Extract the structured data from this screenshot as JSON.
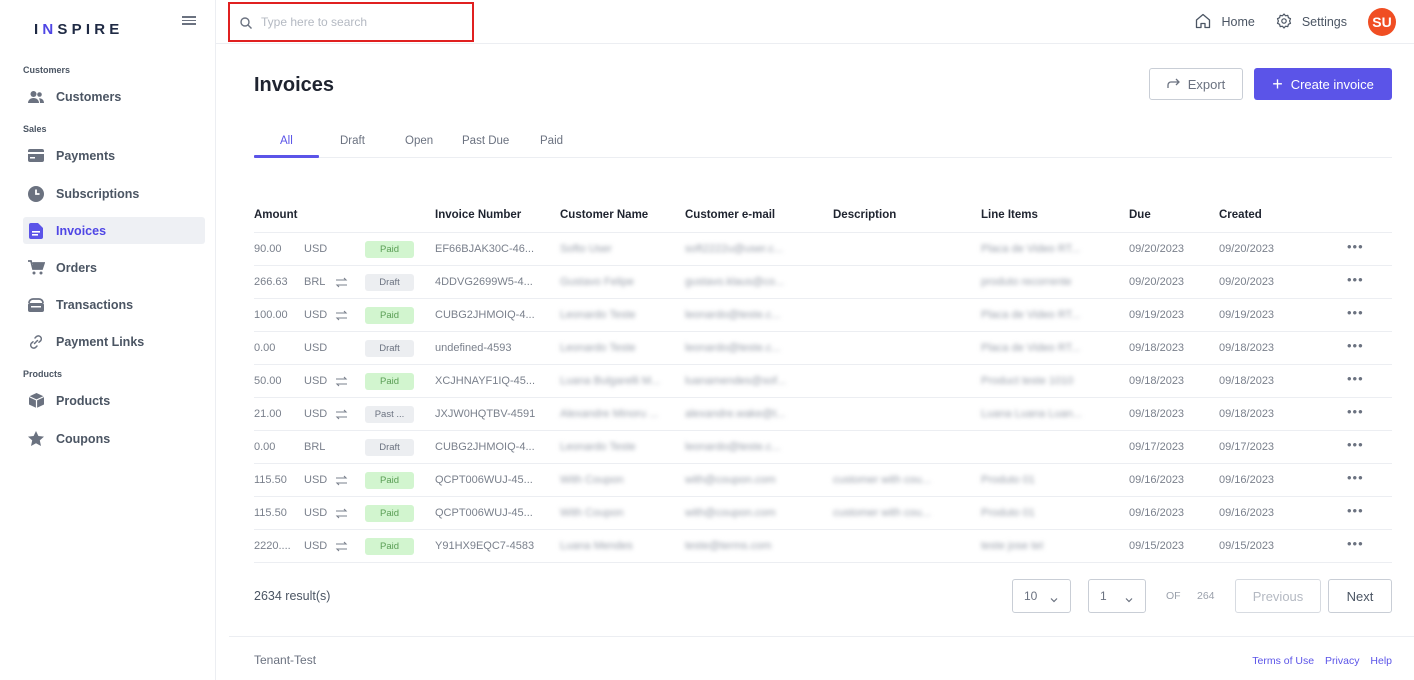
{
  "brand": {
    "logo_pre": "I",
    "logo_accent": "N",
    "logo_post": "SPIRE"
  },
  "sidebar": {
    "sections": [
      {
        "label": "Customers"
      },
      {
        "label": "Sales"
      },
      {
        "label": "Products"
      }
    ],
    "items": [
      {
        "label": "Customers",
        "icon": "users-icon"
      },
      {
        "label": "Payments",
        "icon": "card-icon"
      },
      {
        "label": "Subscriptions",
        "icon": "clock-icon"
      },
      {
        "label": "Invoices",
        "icon": "document-icon",
        "active": true
      },
      {
        "label": "Orders",
        "icon": "cart-icon"
      },
      {
        "label": "Transactions",
        "icon": "wallet-icon"
      },
      {
        "label": "Payment Links",
        "icon": "link-icon"
      },
      {
        "label": "Products",
        "icon": "box-icon"
      },
      {
        "label": "Coupons",
        "icon": "star-icon"
      }
    ]
  },
  "search": {
    "placeholder": "Type here to search"
  },
  "topbar": {
    "home": "Home",
    "settings": "Settings",
    "avatar": "SU"
  },
  "page": {
    "title": "Invoices",
    "export_label": "Export",
    "create_label": "Create invoice"
  },
  "tabs": [
    "All",
    "Draft",
    "Open",
    "Past Due",
    "Paid"
  ],
  "table": {
    "headers": [
      "Amount",
      "Invoice Number",
      "Customer Name",
      "Customer e-mail",
      "Description",
      "Line Items",
      "Due",
      "Created"
    ],
    "rows": [
      {
        "amount": "90.00",
        "currency": "USD",
        "recurring": false,
        "status": "Paid",
        "invoice": "EF66BJAK30C-46...",
        "name": "Softo User",
        "email": "soft2222u@user.c...",
        "description": "",
        "line_items": "Placa de Video RT...",
        "due": "09/20/2023",
        "created": "09/20/2023"
      },
      {
        "amount": "266.63",
        "currency": "BRL",
        "recurring": true,
        "status": "Draft",
        "invoice": "4DDVG2699W5-4...",
        "name": "Gustavo Felipe",
        "email": "gustavo.klaus@co...",
        "description": "",
        "line_items": "produto recorrente",
        "due": "09/20/2023",
        "created": "09/20/2023"
      },
      {
        "amount": "100.00",
        "currency": "USD",
        "recurring": true,
        "status": "Paid",
        "invoice": "CUBG2JHMOIQ-4...",
        "name": "Leonardo Teste",
        "email": "leonardo@teste.c...",
        "description": "",
        "line_items": "Placa de Video RT...",
        "due": "09/19/2023",
        "created": "09/19/2023"
      },
      {
        "amount": "0.00",
        "currency": "USD",
        "recurring": false,
        "status": "Draft",
        "invoice": "undefined-4593",
        "name": "Leonardo Teste",
        "email": "leonardo@teste.c...",
        "description": "",
        "line_items": "Placa de Video RT...",
        "due": "09/18/2023",
        "created": "09/18/2023"
      },
      {
        "amount": "50.00",
        "currency": "USD",
        "recurring": true,
        "status": "Paid",
        "invoice": "XCJHNAYF1IQ-45...",
        "name": "Luana Bulgarelli M...",
        "email": "luanamendes@sof...",
        "description": "",
        "line_items": "Product teste 1010",
        "due": "09/18/2023",
        "created": "09/18/2023"
      },
      {
        "amount": "21.00",
        "currency": "USD",
        "recurring": true,
        "status": "Past ...",
        "invoice": "JXJW0HQTBV-4591",
        "name": "Alexandre Minoru ...",
        "email": "alexandre.wake@t...",
        "description": "",
        "line_items": "Luana Luana Luan...",
        "due": "09/18/2023",
        "created": "09/18/2023"
      },
      {
        "amount": "0.00",
        "currency": "BRL",
        "recurring": false,
        "status": "Draft",
        "invoice": "CUBG2JHMOIQ-4...",
        "name": "Leonardo Teste",
        "email": "leonardo@teste.c...",
        "description": "",
        "line_items": "",
        "due": "09/17/2023",
        "created": "09/17/2023"
      },
      {
        "amount": "115.50",
        "currency": "USD",
        "recurring": true,
        "status": "Paid",
        "invoice": "QCPT006WUJ-45...",
        "name": "With Coupon",
        "email": "with@coupon.com",
        "description": "customer with cou...",
        "line_items": "Produto 01",
        "due": "09/16/2023",
        "created": "09/16/2023"
      },
      {
        "amount": "115.50",
        "currency": "USD",
        "recurring": true,
        "status": "Paid",
        "invoice": "QCPT006WUJ-45...",
        "name": "With Coupon",
        "email": "with@coupon.com",
        "description": "customer with cou...",
        "line_items": "Produto 01",
        "due": "09/16/2023",
        "created": "09/16/2023"
      },
      {
        "amount": "2220....",
        "currency": "USD",
        "recurring": true,
        "status": "Paid",
        "invoice": "Y91HX9EQC7-4583",
        "name": "Luana Mendes",
        "email": "teste@terms.com",
        "description": "",
        "line_items": "teste jose teI",
        "due": "09/15/2023",
        "created": "09/15/2023"
      }
    ]
  },
  "pagination": {
    "results": "2634 result(s)",
    "page_size": "10",
    "page": "1",
    "of": "OF",
    "total_pages": "264",
    "prev": "Previous",
    "next": "Next"
  },
  "footer": {
    "tenant": "Tenant-Test",
    "terms": "Terms of Use",
    "privacy": "Privacy",
    "help": "Help"
  },
  "colors": {
    "accent": "#5b54e8",
    "avatar": "#f04e23",
    "paid_bg": "#d2f5cf",
    "search_highlight": "#e02020"
  }
}
